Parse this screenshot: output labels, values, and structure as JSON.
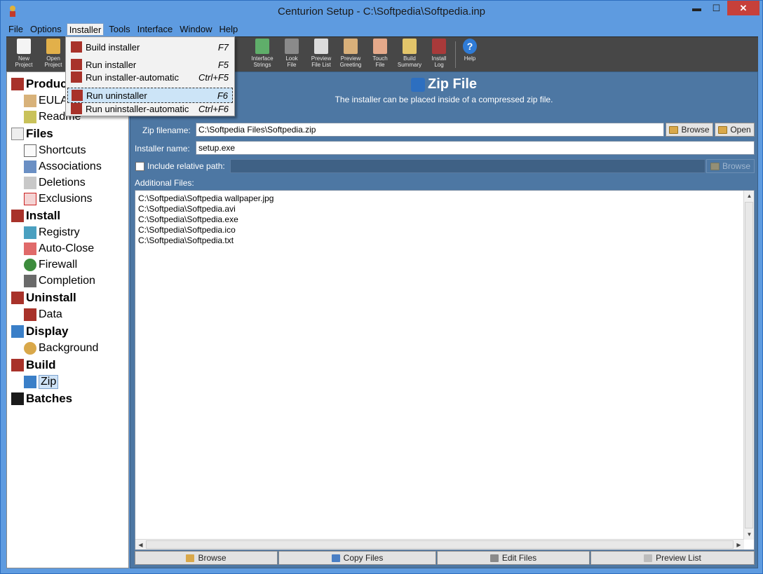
{
  "window": {
    "title": "Centurion Setup - C:\\Softpedia\\Softpedia.inp",
    "controls": {
      "minimize": "▬",
      "maximize": "☐",
      "close": "✕"
    }
  },
  "menubar": {
    "items": [
      "File",
      "Options",
      "Installer",
      "Tools",
      "Interface",
      "Window",
      "Help"
    ],
    "active": "Installer"
  },
  "toolbar": {
    "buttons": [
      {
        "label1": "New",
        "label2": "Project"
      },
      {
        "label1": "Open",
        "label2": "Project"
      },
      {
        "label1": "Interface",
        "label2": "Strings"
      },
      {
        "label1": "Look",
        "label2": "File"
      },
      {
        "label1": "Preview",
        "label2": "File List"
      },
      {
        "label1": "Preview",
        "label2": "Greeting"
      },
      {
        "label1": "Touch",
        "label2": "File"
      },
      {
        "label1": "Build",
        "label2": "Summary"
      },
      {
        "label1": "Install",
        "label2": "Log"
      },
      {
        "label1": "Help",
        "label2": ""
      }
    ]
  },
  "installer_menu": {
    "items": [
      {
        "label": "Build installer",
        "shortcut": "F7"
      },
      {
        "label": "Run installer",
        "shortcut": "F5"
      },
      {
        "label": "Run installer-automatic",
        "shortcut": "Ctrl+F5"
      },
      {
        "label": "Run uninstaller",
        "shortcut": "F6"
      },
      {
        "label": "Run uninstaller-automatic",
        "shortcut": "Ctrl+F6"
      }
    ]
  },
  "tree": {
    "product": "Produc",
    "eula": "EULA",
    "readme": "Readme",
    "files": "Files",
    "shortcuts": "Shortcuts",
    "associations": "Associations",
    "deletions": "Deletions",
    "exclusions": "Exclusions",
    "install": "Install",
    "registry": "Registry",
    "autoclose": "Auto-Close",
    "firewall": "Firewall",
    "completion": "Completion",
    "uninstall": "Uninstall",
    "data": "Data",
    "display": "Display",
    "background": "Background",
    "build": "Build",
    "zip": "Zip",
    "batches": "Batches"
  },
  "panel": {
    "title": "Zip File",
    "subtitle": "The installer can be placed inside of a compressed zip file.",
    "zip_label": "Zip filename:",
    "zip_value": "C:\\Softpedia Files\\Softpedia.zip",
    "browse": "Browse",
    "open": "Open",
    "installer_label": "Installer name:",
    "installer_value": "setup.exe",
    "relative_label": "Include relative path:",
    "relative_browse": "Browse",
    "additional_label": "Additional Files:",
    "files": [
      "C:\\Softpedia\\Softpedia wallpaper.jpg",
      "C:\\Softpedia\\Softpedia.avi",
      "C:\\Softpedia\\Softpedia.exe",
      "C:\\Softpedia\\Softpedia.ico",
      "C:\\Softpedia\\Softpedia.txt"
    ]
  },
  "bottom_buttons": {
    "browse": "Browse",
    "copy": "Copy Files",
    "edit": "Edit Files",
    "preview": "Preview List"
  },
  "colors": {
    "accent": "#5e9be0",
    "panel": "#4d77a3",
    "toolbar": "#474747",
    "close": "#c7403a"
  }
}
